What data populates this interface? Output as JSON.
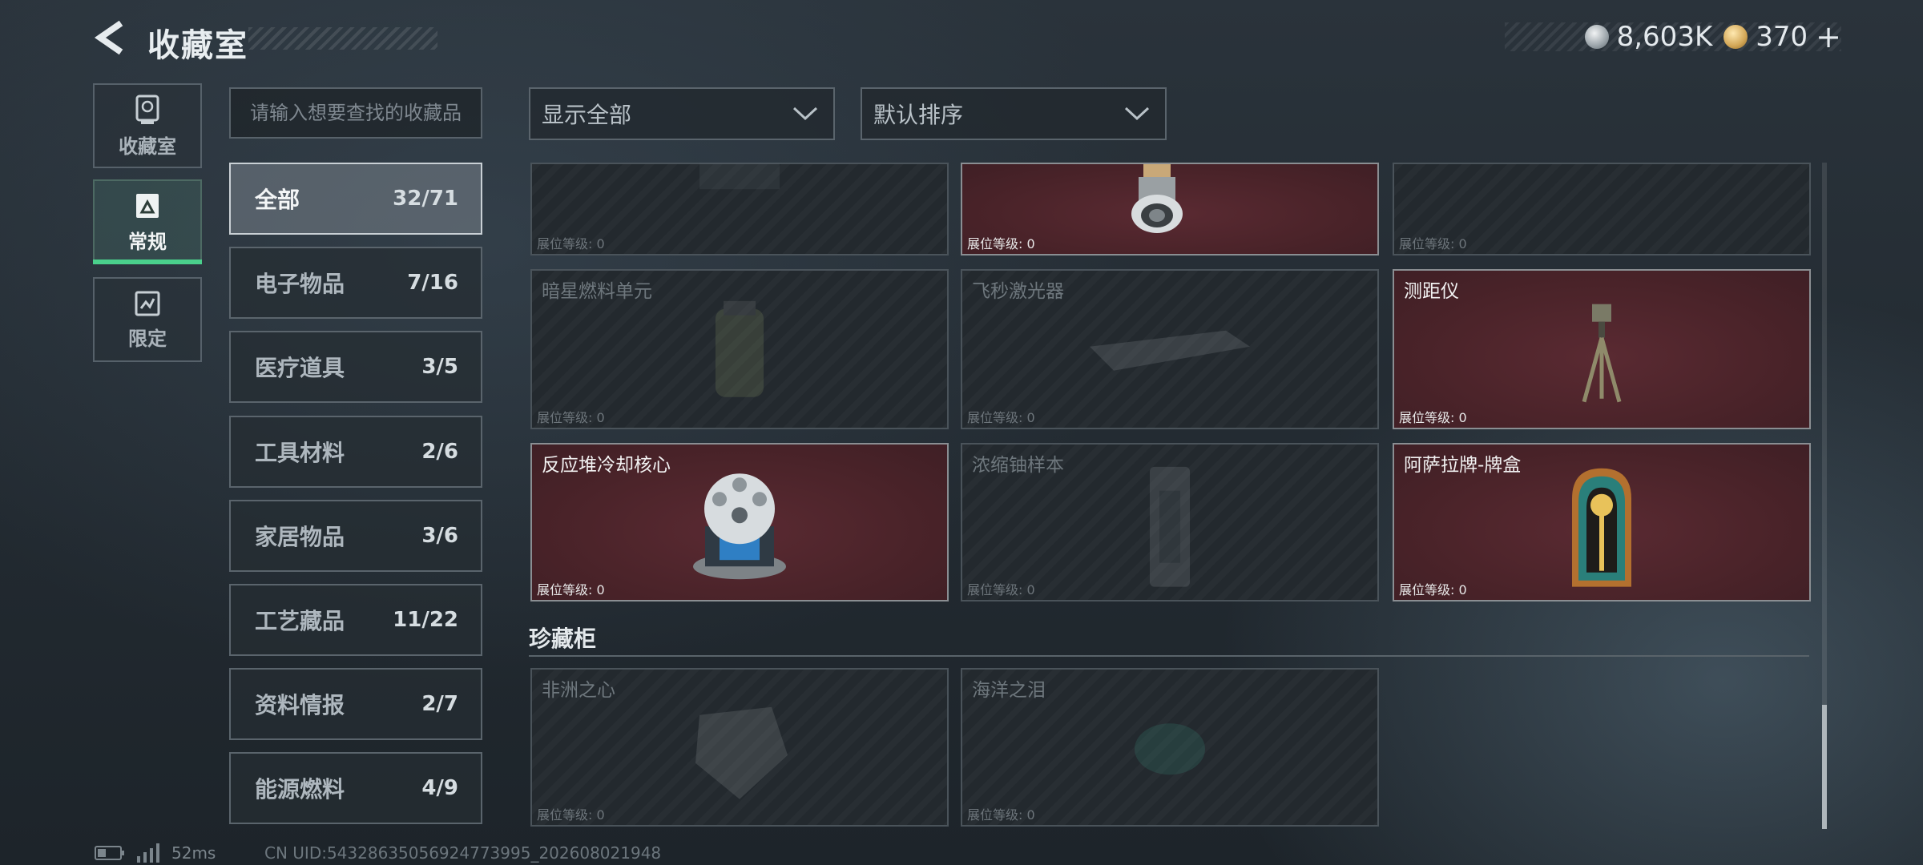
{
  "header": {
    "title": "收藏室",
    "currencies": [
      {
        "icon": "silver-coin-icon",
        "value": "8,603K",
        "color": "#c9ced2"
      },
      {
        "icon": "gold-coin-icon",
        "value": "370",
        "plus": "+",
        "color": "#d9b46a"
      }
    ]
  },
  "rail": [
    {
      "label": "收藏室",
      "icon": "trophy-icon",
      "active": false
    },
    {
      "label": "常规",
      "icon": "card-icon",
      "active": true
    },
    {
      "label": "限定",
      "icon": "limited-icon",
      "active": false
    }
  ],
  "search": {
    "placeholder": "请输入想要查找的收藏品"
  },
  "categories": [
    {
      "name": "全部",
      "count": "32/71",
      "active": true
    },
    {
      "name": "电子物品",
      "count": "7/16"
    },
    {
      "name": "医疗道具",
      "count": "3/5"
    },
    {
      "name": "工具材料",
      "count": "2/6"
    },
    {
      "name": "家居物品",
      "count": "3/6"
    },
    {
      "name": "工艺藏品",
      "count": "11/22"
    },
    {
      "name": "资料情报",
      "count": "2/7"
    },
    {
      "name": "能源燃料",
      "count": "4/9"
    }
  ],
  "filters": {
    "display": "显示全部",
    "sort": "默认排序"
  },
  "level_label": "展位等级: 0",
  "grid": {
    "top_row": [
      {
        "name": "",
        "owned": false
      },
      {
        "name": "",
        "owned": true
      },
      {
        "name": "",
        "owned": false
      }
    ],
    "row2": [
      {
        "name": "暗星燃料单元",
        "owned": false
      },
      {
        "name": "飞秒激光器",
        "owned": false
      },
      {
        "name": "测距仪",
        "owned": true
      }
    ],
    "row3": [
      {
        "name": "反应堆冷却核心",
        "owned": true
      },
      {
        "name": "浓缩铀样本",
        "owned": false
      },
      {
        "name": "阿萨拉牌-牌盒",
        "owned": true
      }
    ],
    "section_title": "珍藏柜",
    "row4": [
      {
        "name": "非洲之心",
        "owned": false
      },
      {
        "name": "海洋之泪",
        "owned": false
      }
    ]
  },
  "status": {
    "ping": "52ms",
    "uid": "CN UID:5432863505692477399​5_202608021948"
  }
}
